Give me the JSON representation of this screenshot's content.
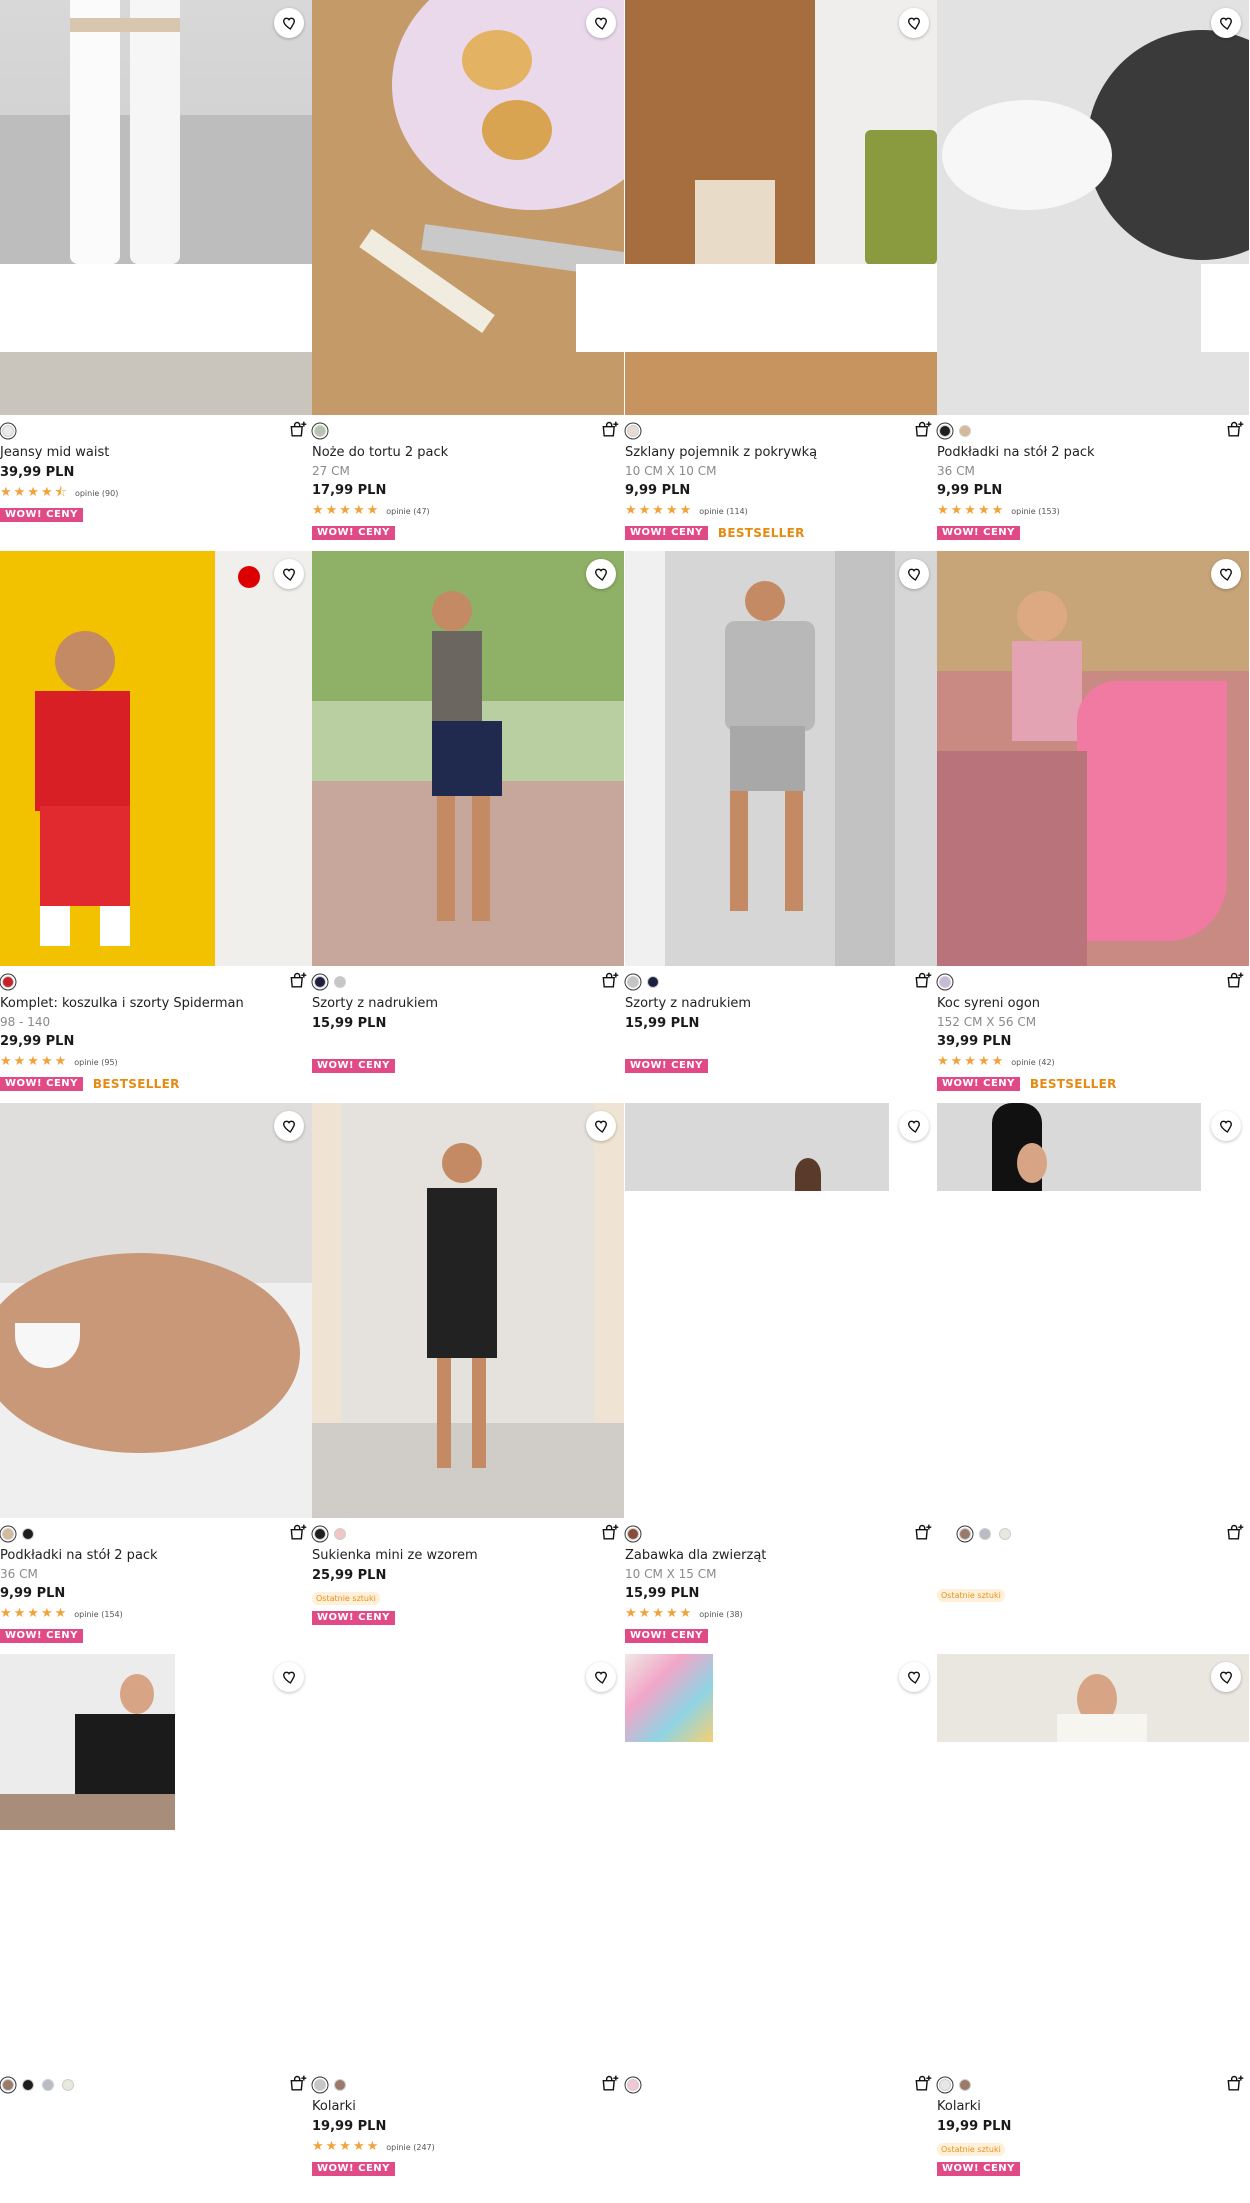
{
  "colors": {
    "wow_bg": "#e04a86",
    "bestseller": "#e58b12",
    "star": "#f2a23a",
    "low_stock_bg": "#fff1d9",
    "low_stock_text": "#e8901f"
  },
  "labels": {
    "wow": "WOW! CENY",
    "bestseller": "BESTSELLER",
    "low_stock": "Ostatnie sztuki"
  },
  "products": [
    {
      "name": "Jeansy mid waist",
      "size": "",
      "price": "39,99 PLN",
      "rating": 4.5,
      "reviews": "opinie (90)",
      "swatches": [
        "#eaeaea"
      ],
      "wow": true,
      "bestseller": false,
      "low_stock": false
    },
    {
      "name": "Noże do tortu 2 pack",
      "size": "27 CM",
      "price": "17,99 PLN",
      "rating": 5,
      "reviews": "opinie (47)",
      "swatches": [
        "#b8c4b2"
      ],
      "wow": true,
      "bestseller": false,
      "low_stock": false
    },
    {
      "name": "Szklany pojemnik z pokrywką",
      "size": "10 CM X 10 CM",
      "price": "9,99 PLN",
      "rating": 5,
      "reviews": "opinie (114)",
      "swatches": [
        "#e7dcd3"
      ],
      "wow": true,
      "bestseller": true,
      "low_stock": false
    },
    {
      "name": "Podkładki na stół 2 pack",
      "size": "36 CM",
      "price": "9,99 PLN",
      "rating": 5,
      "reviews": "opinie (153)",
      "swatches": [
        "#1e1e1e",
        "#d6b89a"
      ],
      "wow": true,
      "bestseller": false,
      "low_stock": false
    },
    {
      "name": "Komplet: koszulka i szorty Spiderman",
      "size": "98 - 140",
      "price": "29,99 PLN",
      "rating": 5,
      "reviews": "opinie (95)",
      "swatches": [
        "#c8202a"
      ],
      "wow": true,
      "bestseller": true,
      "low_stock": false
    },
    {
      "name": "Szorty z nadrukiem",
      "size": "",
      "price": "15,99 PLN",
      "rating": 0,
      "reviews": "",
      "swatches": [
        "#1d2140",
        "#c6c6c6"
      ],
      "wow": true,
      "bestseller": false,
      "low_stock": false
    },
    {
      "name": "Szorty z nadrukiem",
      "size": "",
      "price": "15,99 PLN",
      "rating": 0,
      "reviews": "",
      "swatches": [
        "#c4c4c4",
        "#1d2140"
      ],
      "wow": true,
      "bestseller": false,
      "low_stock": false
    },
    {
      "name": "Koc syreni ogon",
      "size": "152 CM X 56 CM",
      "price": "39,99 PLN",
      "rating": 5,
      "reviews": "opinie (42)",
      "swatches": [
        "#c7b8dc"
      ],
      "wow": true,
      "bestseller": true,
      "low_stock": false
    },
    {
      "name": "Podkładki na stół 2 pack",
      "size": "36 CM",
      "price": "9,99 PLN",
      "rating": 5,
      "reviews": "opinie (154)",
      "swatches": [
        "#d6b89a",
        "#1e1e1e"
      ],
      "wow": true,
      "bestseller": false,
      "low_stock": false
    },
    {
      "name": "Sukienka mini ze wzorem",
      "size": "",
      "price": "25,99 PLN",
      "rating": 0,
      "reviews": "",
      "swatches": [
        "#1e1e1e",
        "#f2c6c6"
      ],
      "wow": true,
      "bestseller": false,
      "low_stock": true
    },
    {
      "name": "Zabawka dla zwierząt",
      "size": "10 CM X 15 CM",
      "price": "15,99 PLN",
      "rating": 5,
      "reviews": "opinie (38)",
      "swatches": [
        "#8a4b3a"
      ],
      "wow": true,
      "bestseller": false,
      "low_stock": false
    },
    {
      "name": "",
      "size": "",
      "price": "",
      "rating": 0,
      "reviews": "",
      "swatches": [
        "#9a7a6a",
        "#b8bcc4",
        "#e6eadc"
      ],
      "wow": false,
      "bestseller": false,
      "low_stock": true
    },
    {
      "name": "",
      "size": "",
      "price": "",
      "rating": 0,
      "reviews": "",
      "swatches": [
        "#9a7a6a",
        "#1e1e1e",
        "#b8bcc4",
        "#e6eadc"
      ],
      "wow": false,
      "bestseller": false,
      "low_stock": false
    },
    {
      "name": "Kolarki",
      "size": "",
      "price": "19,99 PLN",
      "rating": 5,
      "reviews": "opinie (247)",
      "swatches": [
        "#c6c6c6",
        "#9a7a6a"
      ],
      "wow": true,
      "bestseller": false,
      "low_stock": false
    },
    {
      "name": "",
      "size": "",
      "price": "",
      "rating": 0,
      "reviews": "",
      "swatches": [
        "#f2c6d6"
      ],
      "wow": false,
      "bestseller": false,
      "low_stock": false
    },
    {
      "name": "Kolarki",
      "size": "",
      "price": "19,99 PLN",
      "rating": 0,
      "reviews": "",
      "swatches": [
        "#e6e6e6",
        "#9a7a6a"
      ],
      "wow": true,
      "bestseller": false,
      "low_stock": true
    }
  ]
}
